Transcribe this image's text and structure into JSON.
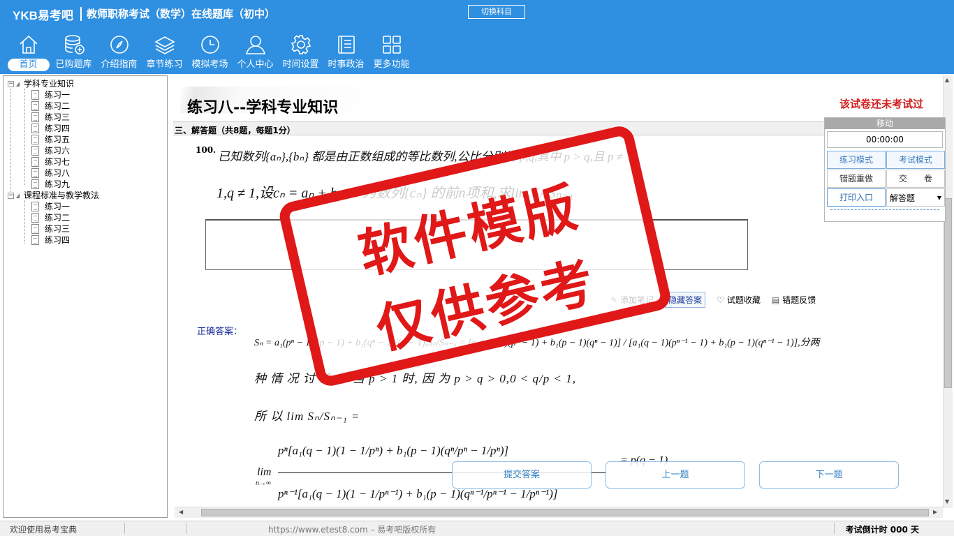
{
  "header": {
    "logo": "YKB易考吧",
    "title": "教师职称考试（数学）在线题库（初中）",
    "switch_subject": "切换科目",
    "nav": [
      {
        "icon": "home-icon",
        "label": "首页"
      },
      {
        "icon": "database-add-icon",
        "label": "已购题库"
      },
      {
        "icon": "compass-icon",
        "label": "介绍指南"
      },
      {
        "icon": "layers-icon",
        "label": "章节练习"
      },
      {
        "icon": "clock-icon",
        "label": "模拟考场"
      },
      {
        "icon": "user-icon",
        "label": "个人中心"
      },
      {
        "icon": "gear-icon",
        "label": "时间设置"
      },
      {
        "icon": "notebook-icon",
        "label": "时事政治"
      },
      {
        "icon": "grid-icon",
        "label": "更多功能"
      }
    ]
  },
  "tree": {
    "groups": [
      {
        "label": "学科专业知识",
        "items": [
          "练习一",
          "练习二",
          "练习三",
          "练习四",
          "练习五",
          "练习六",
          "练习七",
          "练习八",
          "练习九"
        ]
      },
      {
        "label": "课程标准与教学教法",
        "items": [
          "练习一",
          "练习二",
          "练习三",
          "练习四"
        ]
      }
    ]
  },
  "main": {
    "paper_title": "练习八--学科专业知识",
    "exam_status": "该试卷还未考试过",
    "section": "三、解答题（共8题，每题1分）",
    "question_number": "100.",
    "question_line1": "已知数列{aₙ},{bₙ} 都是由正数组成的等比数列,公比分别为 p,q,其中 p > q,且 p ≠",
    "question_line2": "1,q ≠ 1,设cₙ = aₙ + bₙ,Sₙ 为数列{cₙ} 的前n项和,求lim Sₙ/Sₙ₋₁",
    "tools": {
      "add_note": "添加笔记",
      "hide_answer": "隐藏答案",
      "favorite": "试题收藏",
      "feedback": "错题反馈"
    },
    "answer_label": "正确答案：",
    "answer_line1": "Sₙ = a₁(pⁿ − 1)/(p − 1) + b₁(qⁿ − 1)/(q − 1),Sₙ/Sₙ₋₁ = [a₁(q − 1)(pⁿ − 1) + b₁(p − 1)(qⁿ − 1)] / [a₁(q − 1)(pⁿ⁻¹ − 1) + b₁(p − 1)(qⁿ⁻¹ − 1)],分两",
    "answer_line2": "种 情 况 讨 论:① 当 p > 1 时, 因 为 p > q > 0,0 < q/p < 1,",
    "answer_line3": "所 以 lim Sₙ/Sₙ₋₁ =",
    "answer_line4_num": "pⁿ[a₁(q − 1)(1 − 1/pⁿ) + b₁(p − 1)(qⁿ/pⁿ − 1/pⁿ)]",
    "answer_line4_den": "pⁿ⁻¹[a₁(q − 1)(1 − 1/pⁿ⁻¹) + b₁(p − 1)(qⁿ⁻¹/pⁿ⁻¹ − 1/pⁿ⁻¹)]",
    "answer_line4_lim": "lim",
    "answer_line4_sub": "n→∞",
    "answer_line4_tail": "= p(q − 1)",
    "buttons": {
      "submit": "提交答案",
      "prev": "上一题",
      "next": "下一题"
    }
  },
  "panel": {
    "head": "移动",
    "timer": "00:00:00",
    "practice_mode": "练习模式",
    "exam_mode": "考试模式",
    "redo_wrong": "错题重做",
    "submit_paper": "交　　卷",
    "print": "打印入口",
    "question_type": "解答题"
  },
  "watermark": {
    "line1": "软件模版",
    "line2": "仅供参考"
  },
  "status": {
    "welcome": "欢迎使用易考宝典",
    "url": "https://www.etest8.com – 易考吧版权所有",
    "countdown": "考试倒计时 000 天"
  },
  "colors": {
    "header_blue": "#2f8fe0",
    "stamp_red": "#e01818",
    "status_red": "#d21f1f"
  }
}
